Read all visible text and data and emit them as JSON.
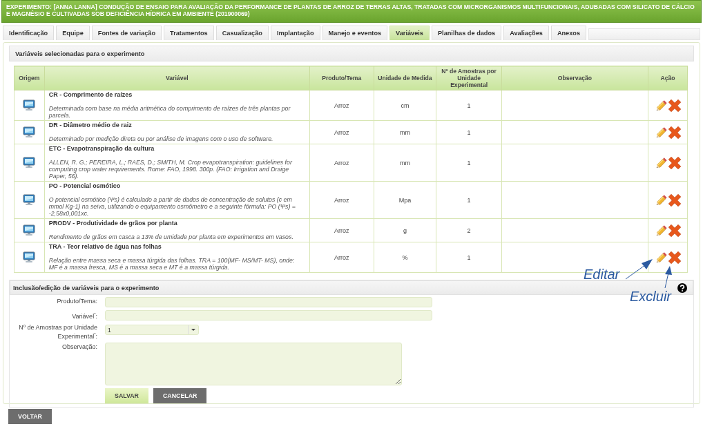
{
  "header": {
    "title": "EXPERIMENTO: [ANNA LANNA] CONDUÇÃO DE ENSAIO PARA AVALIAÇÃO DA PERFORMANCE DE PLANTAS DE ARROZ DE TERRAS ALTAS, TRATADAS COM MICRORGANISMOS MULTIFUNCIONAIS, ADUBADAS COM SILICATO DE CÁLCIO E MAGNÉSIO E CULTIVADAS SOB DEFICIÊNCIA HÍDRICA EM AMBIENTE (201900069)"
  },
  "tabs": [
    {
      "label": "Identificação",
      "selected": false
    },
    {
      "label": "Equipe",
      "selected": false
    },
    {
      "label": "Fontes de variação",
      "selected": false
    },
    {
      "label": "Tratamentos",
      "selected": false
    },
    {
      "label": "Casualização",
      "selected": false
    },
    {
      "label": "Implantação",
      "selected": false
    },
    {
      "label": "Manejo e eventos",
      "selected": false
    },
    {
      "label": "Variáveis",
      "selected": true
    },
    {
      "label": "Planilhas de dados",
      "selected": false
    },
    {
      "label": "Avaliações",
      "selected": false
    },
    {
      "label": "Anexos",
      "selected": false
    }
  ],
  "variables_panel": {
    "title": "Variáveis selecionadas para o experimento",
    "table": {
      "columns": [
        "Origem",
        "Variável",
        "Produto/Tema",
        "Unidade de Medida",
        "Nº de Amostras por Unidade Experimental",
        "Observação",
        "Ação"
      ],
      "rows": [
        {
          "name": "CR - Comprimento de raízes",
          "description": "Determinada com base na média aritmética do comprimento de raízes de três plantas por parcela.",
          "product": "Arroz",
          "unit": "cm",
          "samples": "1"
        },
        {
          "name": "DR - Diâmetro médio de raiz",
          "description": "Determinado por medição direta ou por análise de imagens com o uso de software.",
          "product": "Arroz",
          "unit": "mm",
          "samples": "1"
        },
        {
          "name": "ETC - Evapotranspiração da cultura",
          "description": "ALLEN, R. G.; PEREIRA, L.; RAES, D.; SMITH, M. Crop evapotranspiration: guidelines for computing crop water requirements. Rome: FAO, 1998. 300p. (FAO: Irrigation and Draige Paper, 56).",
          "product": "Arroz",
          "unit": "mm",
          "samples": "1"
        },
        {
          "name": "PO - Potencial osmótico",
          "description": "O potencial osmótico (Ψs) é calculado a partir de dados de concentração de solutos (c em mmol Kg-1) na seiva, utilizando o equipamento osmômetro e a seguinte fórmula: PO (Ψs) = -2,58x0,001xc.",
          "product": "Arroz",
          "unit": "Mpa",
          "samples": "1"
        },
        {
          "name": "PRODV - Produtividade de grãos por planta",
          "description": "Rendimento de grãos em casca a 13% de umidade por planta em experimentos em vasos.",
          "product": "Arroz",
          "unit": "g",
          "samples": "2"
        },
        {
          "name": "TRA - Teor relativo de água nas folhas",
          "description": "Relação entre massa seca e massa túrgida das folhas. TRA = 100(MF- MS/MT- MS), onde: MF é a massa fresca, MS é a massa seca e MT é a massa túrgida.",
          "product": "Arroz",
          "unit": "%",
          "samples": "1"
        }
      ]
    }
  },
  "form": {
    "title": "Inclusão/edição de variáveis para o experimento",
    "fields": [
      {
        "kind": "text",
        "label": "Produto/Tema:"
      },
      {
        "kind": "text",
        "label": "Variável$^{*}$:"
      },
      {
        "kind": "select",
        "label": "Nº de Amostras por Unidade Experimental$^{*}$:",
        "value": "1"
      },
      {
        "kind": "textarea",
        "label": "Observação:"
      }
    ],
    "buttons": [
      {
        "label": "SALVAR",
        "kind": "primary"
      },
      {
        "label": "CANCELAR",
        "kind": "secondary"
      }
    ]
  },
  "back_button": {
    "label": "VOLTAR"
  },
  "annotations": [
    {
      "text": "Editar"
    },
    {
      "text": "Excluir"
    }
  ]
}
